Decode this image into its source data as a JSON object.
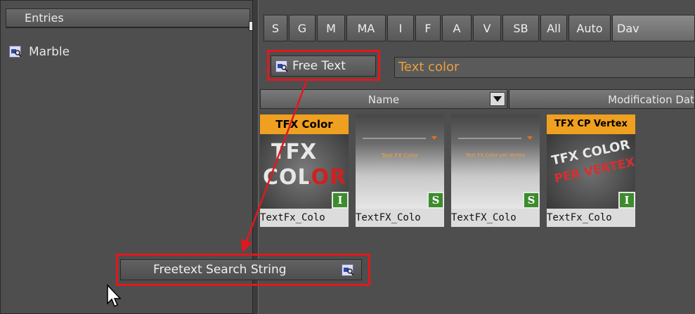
{
  "left_panel": {
    "header": "Entries",
    "items": [
      {
        "label": "Marble",
        "icon": "search-folder-icon"
      }
    ]
  },
  "tabs": [
    "S",
    "G",
    "M",
    "MA",
    "I",
    "F",
    "A",
    "V",
    "SB",
    "All",
    "Auto",
    "Dav"
  ],
  "active_tab": "Dav",
  "filter": {
    "freetext_button": "Free Text",
    "text_color_label": "Text color"
  },
  "columns": {
    "name": "Name",
    "modification": "Modification Dat"
  },
  "tiles": [
    {
      "band": "TFX Color",
      "thumb_lines": [
        "TFX",
        "COLOR"
      ],
      "badge": "I",
      "label": "TextFx_Colo"
    },
    {
      "band": "",
      "thumb_lines": [
        "Text FX Color"
      ],
      "badge": "S",
      "label": "TextFX_Colo"
    },
    {
      "band": "",
      "thumb_lines": [
        "Text FX Color per Vertex"
      ],
      "badge": "S",
      "label": "TextFX_Colo"
    },
    {
      "band": "TFX CP Vertex",
      "thumb_lines": [
        "TFX COLOR",
        "PER VERTEX"
      ],
      "badge": "I",
      "label": "TextFx_Colo"
    }
  ],
  "search_string": {
    "label": "Freetext Search String",
    "icon": "search-folder-icon"
  },
  "colors": {
    "highlight": "#e0181e",
    "band": "#f0a020",
    "text_color": "#e8a040",
    "badge": "#3c8c2c"
  }
}
